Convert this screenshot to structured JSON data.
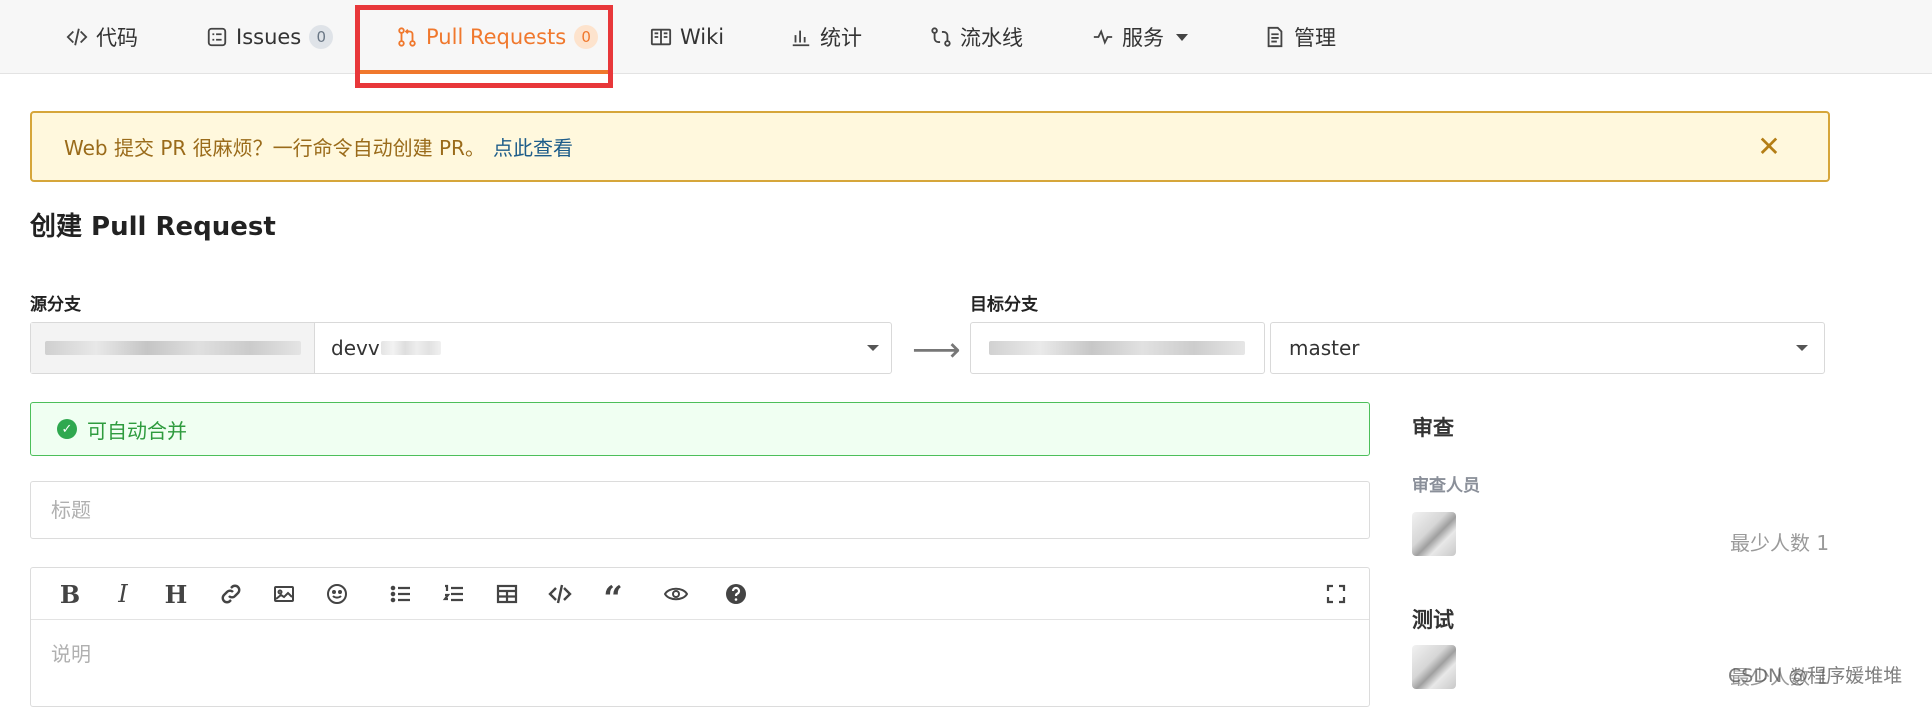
{
  "nav": {
    "items": [
      {
        "label": "代码",
        "icon": "code-icon"
      },
      {
        "label": "Issues",
        "count": "0",
        "icon": "issues-icon"
      },
      {
        "label": "Pull Requests",
        "count": "0",
        "icon": "pull-request-icon",
        "active": true
      },
      {
        "label": "Wiki",
        "icon": "book-icon"
      },
      {
        "label": "统计",
        "icon": "bar-chart-icon"
      },
      {
        "label": "流水线",
        "icon": "pipeline-icon"
      },
      {
        "label": "服务",
        "icon": "pulse-icon",
        "has_dropdown": true
      },
      {
        "label": "管理",
        "icon": "document-icon"
      }
    ],
    "active_color": "#f0782d"
  },
  "notice": {
    "text": "Web 提交 PR 很麻烦？一行命令自动创建 PR。",
    "link": "点此查看",
    "close_icon": "close-icon"
  },
  "page": {
    "title": "创建 Pull Request"
  },
  "source": {
    "label": "源分支",
    "branch": "devv"
  },
  "target": {
    "label": "目标分支",
    "branch": "master"
  },
  "merge_status": {
    "text": "可自动合并",
    "color": "#2e9b3e"
  },
  "form": {
    "title_placeholder": "标题",
    "description_placeholder": "说明"
  },
  "editor": {
    "toolbar": [
      "bold",
      "italic",
      "heading",
      "link",
      "image",
      "emoji",
      "bullet-list",
      "numbered-list",
      "table",
      "code",
      "quote",
      "preview",
      "help",
      "fullscreen"
    ]
  },
  "sidebar": {
    "review": {
      "title": "审查",
      "subtitle": "审查人员",
      "min_label": "最少人数 1"
    },
    "test": {
      "title": "测试",
      "min_label": "最少人数 1"
    }
  },
  "watermark": "CSDN @程序媛堆堆"
}
